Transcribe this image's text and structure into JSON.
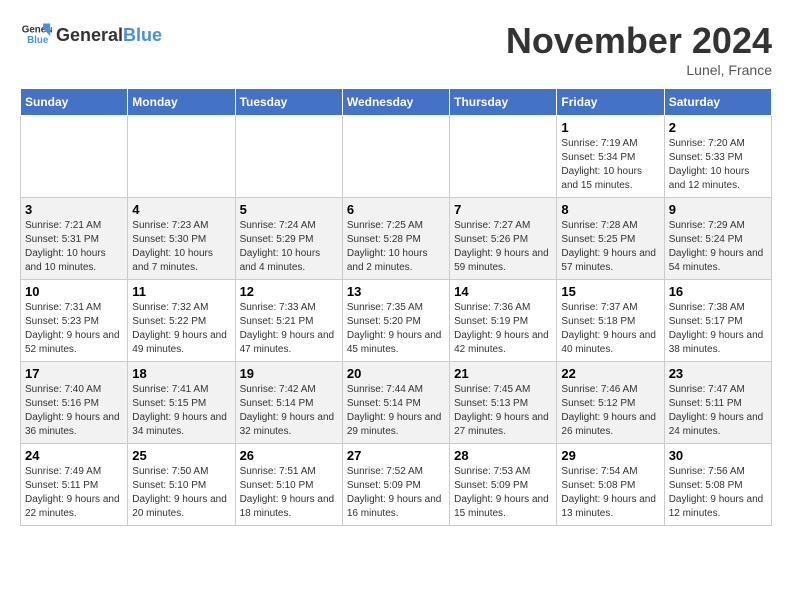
{
  "logo": {
    "line1": "General",
    "line2": "Blue"
  },
  "title": "November 2024",
  "location": "Lunel, France",
  "days_header": [
    "Sunday",
    "Monday",
    "Tuesday",
    "Wednesday",
    "Thursday",
    "Friday",
    "Saturday"
  ],
  "weeks": [
    [
      {
        "day": "",
        "info": ""
      },
      {
        "day": "",
        "info": ""
      },
      {
        "day": "",
        "info": ""
      },
      {
        "day": "",
        "info": ""
      },
      {
        "day": "",
        "info": ""
      },
      {
        "day": "1",
        "info": "Sunrise: 7:19 AM\nSunset: 5:34 PM\nDaylight: 10 hours and 15 minutes."
      },
      {
        "day": "2",
        "info": "Sunrise: 7:20 AM\nSunset: 5:33 PM\nDaylight: 10 hours and 12 minutes."
      }
    ],
    [
      {
        "day": "3",
        "info": "Sunrise: 7:21 AM\nSunset: 5:31 PM\nDaylight: 10 hours and 10 minutes."
      },
      {
        "day": "4",
        "info": "Sunrise: 7:23 AM\nSunset: 5:30 PM\nDaylight: 10 hours and 7 minutes."
      },
      {
        "day": "5",
        "info": "Sunrise: 7:24 AM\nSunset: 5:29 PM\nDaylight: 10 hours and 4 minutes."
      },
      {
        "day": "6",
        "info": "Sunrise: 7:25 AM\nSunset: 5:28 PM\nDaylight: 10 hours and 2 minutes."
      },
      {
        "day": "7",
        "info": "Sunrise: 7:27 AM\nSunset: 5:26 PM\nDaylight: 9 hours and 59 minutes."
      },
      {
        "day": "8",
        "info": "Sunrise: 7:28 AM\nSunset: 5:25 PM\nDaylight: 9 hours and 57 minutes."
      },
      {
        "day": "9",
        "info": "Sunrise: 7:29 AM\nSunset: 5:24 PM\nDaylight: 9 hours and 54 minutes."
      }
    ],
    [
      {
        "day": "10",
        "info": "Sunrise: 7:31 AM\nSunset: 5:23 PM\nDaylight: 9 hours and 52 minutes."
      },
      {
        "day": "11",
        "info": "Sunrise: 7:32 AM\nSunset: 5:22 PM\nDaylight: 9 hours and 49 minutes."
      },
      {
        "day": "12",
        "info": "Sunrise: 7:33 AM\nSunset: 5:21 PM\nDaylight: 9 hours and 47 minutes."
      },
      {
        "day": "13",
        "info": "Sunrise: 7:35 AM\nSunset: 5:20 PM\nDaylight: 9 hours and 45 minutes."
      },
      {
        "day": "14",
        "info": "Sunrise: 7:36 AM\nSunset: 5:19 PM\nDaylight: 9 hours and 42 minutes."
      },
      {
        "day": "15",
        "info": "Sunrise: 7:37 AM\nSunset: 5:18 PM\nDaylight: 9 hours and 40 minutes."
      },
      {
        "day": "16",
        "info": "Sunrise: 7:38 AM\nSunset: 5:17 PM\nDaylight: 9 hours and 38 minutes."
      }
    ],
    [
      {
        "day": "17",
        "info": "Sunrise: 7:40 AM\nSunset: 5:16 PM\nDaylight: 9 hours and 36 minutes."
      },
      {
        "day": "18",
        "info": "Sunrise: 7:41 AM\nSunset: 5:15 PM\nDaylight: 9 hours and 34 minutes."
      },
      {
        "day": "19",
        "info": "Sunrise: 7:42 AM\nSunset: 5:14 PM\nDaylight: 9 hours and 32 minutes."
      },
      {
        "day": "20",
        "info": "Sunrise: 7:44 AM\nSunset: 5:14 PM\nDaylight: 9 hours and 29 minutes."
      },
      {
        "day": "21",
        "info": "Sunrise: 7:45 AM\nSunset: 5:13 PM\nDaylight: 9 hours and 27 minutes."
      },
      {
        "day": "22",
        "info": "Sunrise: 7:46 AM\nSunset: 5:12 PM\nDaylight: 9 hours and 26 minutes."
      },
      {
        "day": "23",
        "info": "Sunrise: 7:47 AM\nSunset: 5:11 PM\nDaylight: 9 hours and 24 minutes."
      }
    ],
    [
      {
        "day": "24",
        "info": "Sunrise: 7:49 AM\nSunset: 5:11 PM\nDaylight: 9 hours and 22 minutes."
      },
      {
        "day": "25",
        "info": "Sunrise: 7:50 AM\nSunset: 5:10 PM\nDaylight: 9 hours and 20 minutes."
      },
      {
        "day": "26",
        "info": "Sunrise: 7:51 AM\nSunset: 5:10 PM\nDaylight: 9 hours and 18 minutes."
      },
      {
        "day": "27",
        "info": "Sunrise: 7:52 AM\nSunset: 5:09 PM\nDaylight: 9 hours and 16 minutes."
      },
      {
        "day": "28",
        "info": "Sunrise: 7:53 AM\nSunset: 5:09 PM\nDaylight: 9 hours and 15 minutes."
      },
      {
        "day": "29",
        "info": "Sunrise: 7:54 AM\nSunset: 5:08 PM\nDaylight: 9 hours and 13 minutes."
      },
      {
        "day": "30",
        "info": "Sunrise: 7:56 AM\nSunset: 5:08 PM\nDaylight: 9 hours and 12 minutes."
      }
    ]
  ]
}
